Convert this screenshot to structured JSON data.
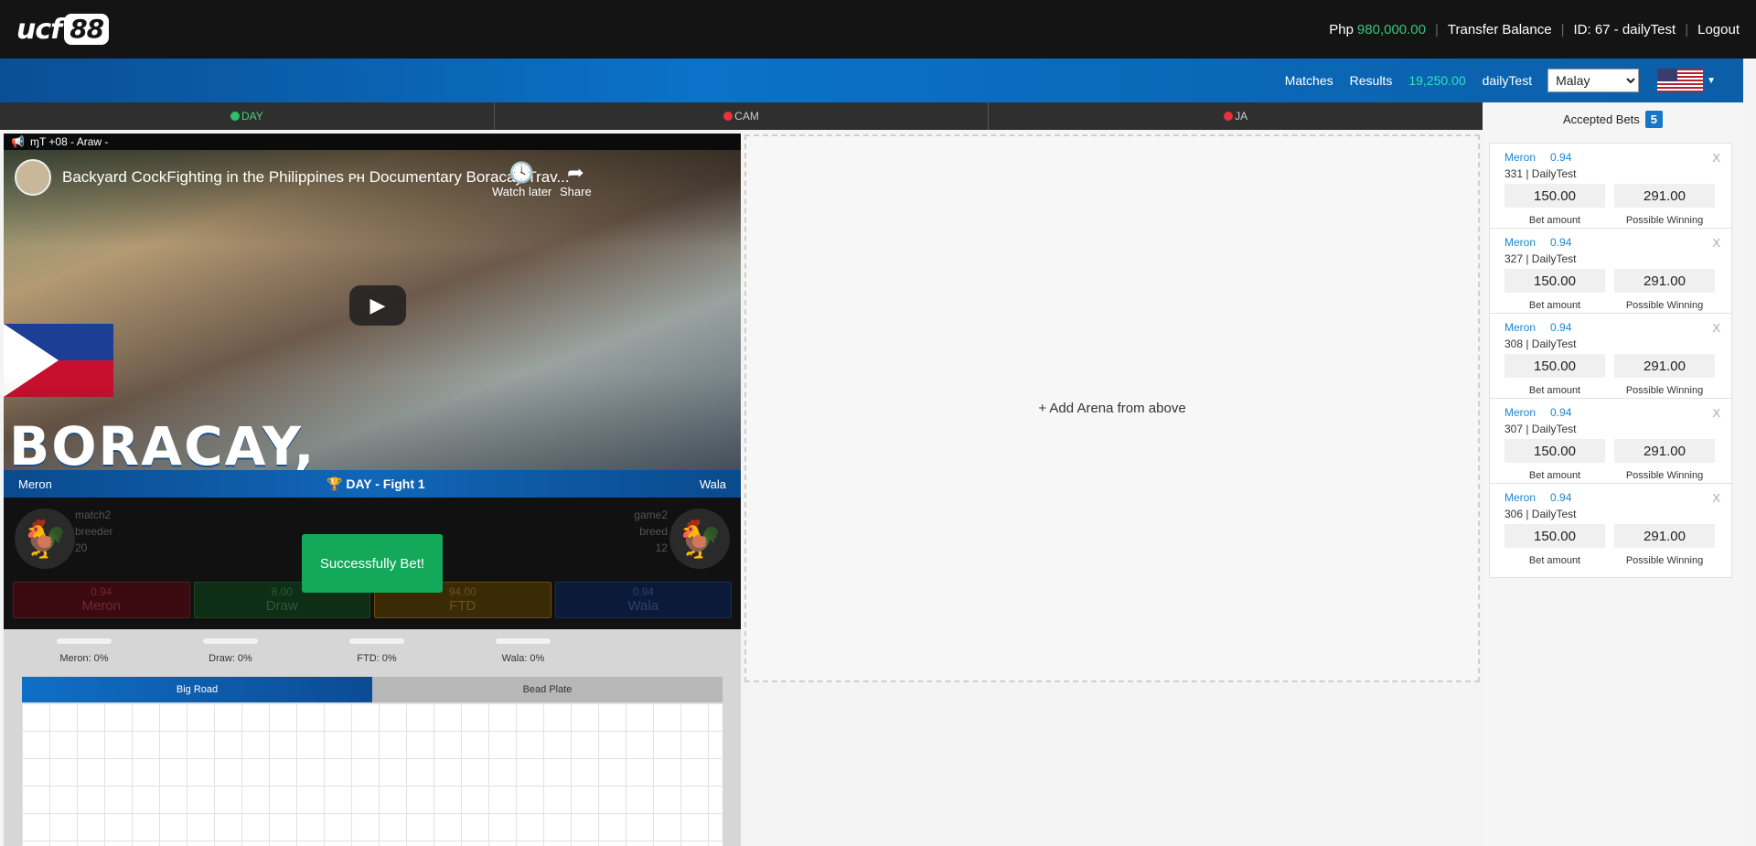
{
  "header": {
    "logo_text": "ucf",
    "logo_num": "88",
    "currency": "Php",
    "balance": "980,000.00",
    "transfer_label": "Transfer Balance",
    "user_id": "ID: 67 - dailyTest",
    "logout_label": "Logout"
  },
  "nav": {
    "matches": "Matches",
    "results": "Results",
    "credit": "19,250.00",
    "username": "dailyTest",
    "language": "Malay",
    "flag": "us-flag-icon"
  },
  "arena_tabs": [
    {
      "label": "DAY",
      "status": "green"
    },
    {
      "label": "CAM",
      "status": "red"
    },
    {
      "label": "JA",
      "status": "red"
    }
  ],
  "video": {
    "header": "ɱT +08 - Araw -",
    "title": "Backyard CockFighting in the Philippines ᴘʜ Documentary Boracay Trav...",
    "watch_later": "Watch later",
    "share": "Share",
    "overlay_text": "BORACAY,"
  },
  "fight": {
    "left": "Meron",
    "title": "DAY - Fight 1",
    "right": "Wala"
  },
  "meron_info": {
    "name": "match2",
    "breed": "breeder",
    "weight": "20"
  },
  "wala_info": {
    "name": "game2",
    "breed": "breed",
    "weight": "12"
  },
  "odds": [
    {
      "value": "0.94",
      "name": "Meron"
    },
    {
      "value": "8.00",
      "name": "Draw"
    },
    {
      "value": "94.00",
      "name": "FTD"
    },
    {
      "value": "0.94",
      "name": "Wala"
    }
  ],
  "toast": "Successfully Bet!",
  "stats": [
    {
      "label": "Meron: 0%"
    },
    {
      "label": "Draw: 0%"
    },
    {
      "label": "FTD: 0%"
    },
    {
      "label": "Wala: 0%"
    }
  ],
  "road_tabs": {
    "big_road": "Big Road",
    "bead_plate": "Bead Plate"
  },
  "dropzone": "+ Add Arena from above",
  "accepted": {
    "label": "Accepted Bets",
    "count": "5"
  },
  "bets": [
    {
      "side": "Meron",
      "odds": "0.94",
      "id": "331 | DailyTest",
      "amount": "150.00",
      "winning": "291.00",
      "amount_label": "Bet amount",
      "winning_label": "Possible Winning",
      "close": "X"
    },
    {
      "side": "Meron",
      "odds": "0.94",
      "id": "327 | DailyTest",
      "amount": "150.00",
      "winning": "291.00",
      "amount_label": "Bet amount",
      "winning_label": "Possible Winning",
      "close": "X"
    },
    {
      "side": "Meron",
      "odds": "0.94",
      "id": "308 | DailyTest",
      "amount": "150.00",
      "winning": "291.00",
      "amount_label": "Bet amount",
      "winning_label": "Possible Winning",
      "close": "X"
    },
    {
      "side": "Meron",
      "odds": "0.94",
      "id": "307 | DailyTest",
      "amount": "150.00",
      "winning": "291.00",
      "amount_label": "Bet amount",
      "winning_label": "Possible Winning",
      "close": "X"
    },
    {
      "side": "Meron",
      "odds": "0.94",
      "id": "306 | DailyTest",
      "amount": "150.00",
      "winning": "291.00",
      "amount_label": "Bet amount",
      "winning_label": "Possible Winning",
      "close": "X"
    }
  ]
}
